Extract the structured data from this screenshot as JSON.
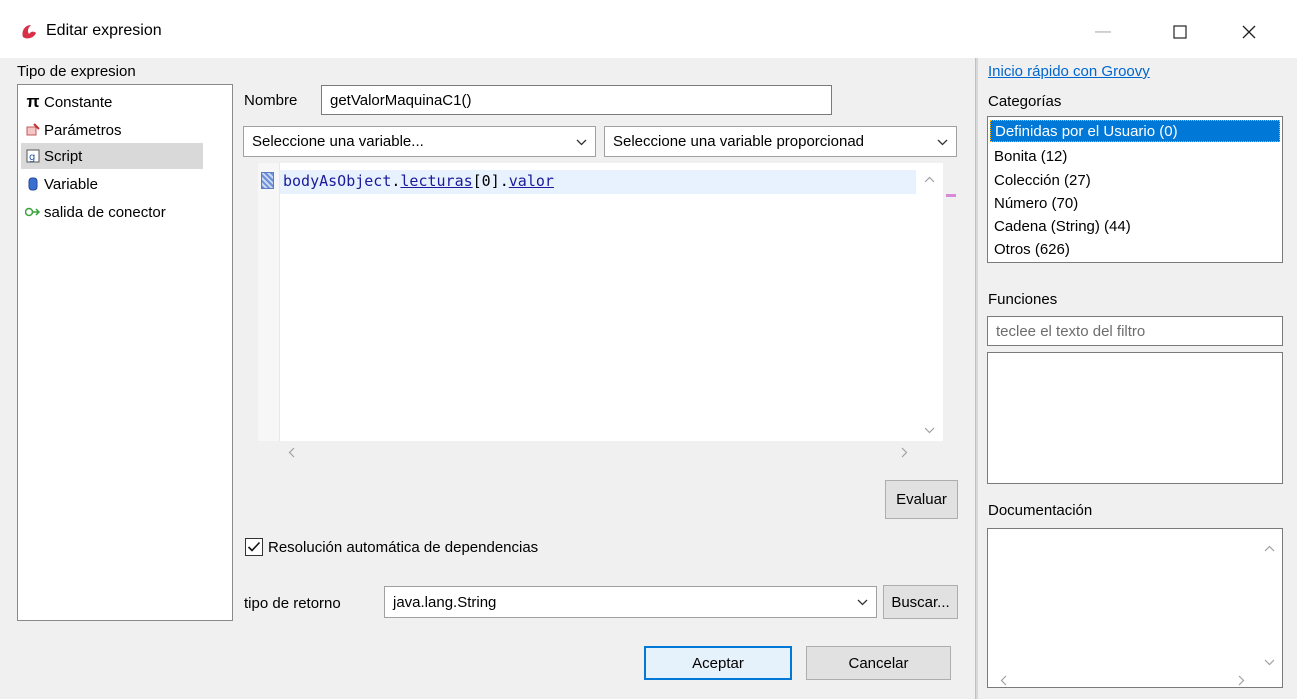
{
  "window": {
    "title": "Editar expresion",
    "min_icon": "minimize-icon",
    "max_icon": "maximize-icon",
    "close_icon": "close-icon"
  },
  "left": {
    "heading": "Tipo de expresion",
    "items": [
      {
        "label": "Constante",
        "icon": "pi-icon"
      },
      {
        "label": "Parámetros",
        "icon": "parameters-icon"
      },
      {
        "label": "Script",
        "icon": "script-icon"
      },
      {
        "label": "Variable",
        "icon": "variable-icon"
      },
      {
        "label": "salida de conector",
        "icon": "connector-output-icon"
      }
    ],
    "selected": "Script"
  },
  "form": {
    "name_label": "Nombre",
    "name_value": "getValorMaquinaC1()",
    "variable_select": "Seleccione una variable...",
    "provided_variable_select": "Seleccione una variable proporcionad",
    "code": {
      "obj": "bodyAsObject",
      "dot1": ".",
      "field1": "lecturas",
      "index": "[0]",
      "dot2": ".",
      "field2": "valor"
    },
    "evaluate_label": "Evaluar",
    "auto_deps_label": "Resolución automática de dependencias",
    "auto_deps_checked": true,
    "return_type_label": "tipo de retorno",
    "return_type_value": "java.lang.String",
    "search_label": "Buscar...",
    "ok_label": "Aceptar",
    "cancel_label": "Cancelar"
  },
  "right": {
    "quickstart_link": "Inicio rápido con Groovy",
    "categories_heading": "Categorías",
    "categories": [
      "Definidas por el Usuario (0)",
      "Bonita (12)",
      "Colección (27)",
      "Número (70)",
      "Cadena (String) (44)",
      "Otros (626)"
    ],
    "selected_category": "Definidas por el Usuario (0)",
    "functions_heading": "Funciones",
    "filter_placeholder": "teclee el texto del filtro",
    "documentation_heading": "Documentación"
  },
  "colors": {
    "accent": "#0078d7",
    "link": "#0066cc",
    "app_icon": "#d9304a"
  }
}
